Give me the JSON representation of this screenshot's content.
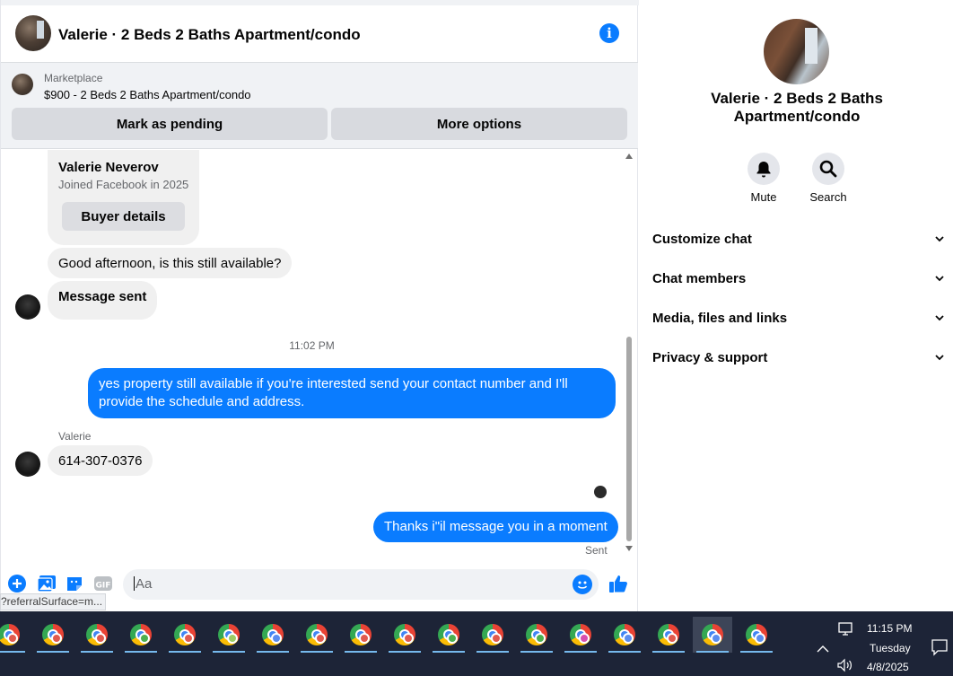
{
  "header": {
    "title": "Valerie · 2 Beds 2 Baths Apartment/condo",
    "info_icon": "info-icon"
  },
  "listing": {
    "source": "Marketplace",
    "title": "$900 - 2 Beds 2 Baths Apartment/condo",
    "mark_pending_label": "Mark as pending",
    "more_options_label": "More options"
  },
  "buyer_card": {
    "name": "Valerie Neverov",
    "joined": "Joined Facebook in 2025",
    "details_label": "Buyer details"
  },
  "messages": [
    {
      "direction": "in",
      "text": "Good afternoon, is this still available?"
    },
    {
      "direction": "in",
      "text": "Message sent"
    },
    {
      "type": "timestamp",
      "text": "11:02 PM"
    },
    {
      "direction": "out",
      "text": "yes property still available if you're interested send your contact number and I'll provide the schedule and address."
    },
    {
      "type": "sender",
      "text": "Valerie"
    },
    {
      "direction": "in",
      "text": "614-307-0376"
    },
    {
      "direction": "out",
      "text": "Thanks i\"il message you in a moment"
    },
    {
      "type": "status",
      "text": "Sent"
    }
  ],
  "composer": {
    "placeholder": "Aa",
    "icons": [
      "plus-icon",
      "image-icon",
      "sticker-icon",
      "gif-icon",
      "emoji-icon",
      "thumbs-up-icon"
    ],
    "gif_label": "GIF"
  },
  "status_url": "?referralSurface=m...",
  "info_panel": {
    "name": "Valerie · 2 Beds 2 Baths Apartment/condo",
    "actions": [
      {
        "label": "Mute",
        "icon": "bell-icon"
      },
      {
        "label": "Search",
        "icon": "search-icon"
      }
    ],
    "sections": [
      {
        "label": "Customize chat"
      },
      {
        "label": "Chat members"
      },
      {
        "label": "Media, files and links"
      },
      {
        "label": "Privacy & support"
      }
    ]
  },
  "taskbar": {
    "apps": [
      "chrome-icon",
      "chrome-icon",
      "chrome-icon",
      "chrome-icon",
      "chrome-icon",
      "chrome-icon",
      "chrome-icon",
      "chrome-icon",
      "chrome-icon",
      "chrome-icon",
      "chrome-icon",
      "chrome-icon",
      "chrome-icon",
      "chrome-icon",
      "chrome-icon",
      "chrome-icon",
      "chrome-icon",
      "chrome-icon"
    ],
    "time": "11:15 PM",
    "day": "Tuesday",
    "date": "4/8/2025"
  },
  "colors": {
    "accent": "#0a7cff",
    "bubble_in": "#f0f0f0",
    "taskbar": "#1d2437"
  }
}
